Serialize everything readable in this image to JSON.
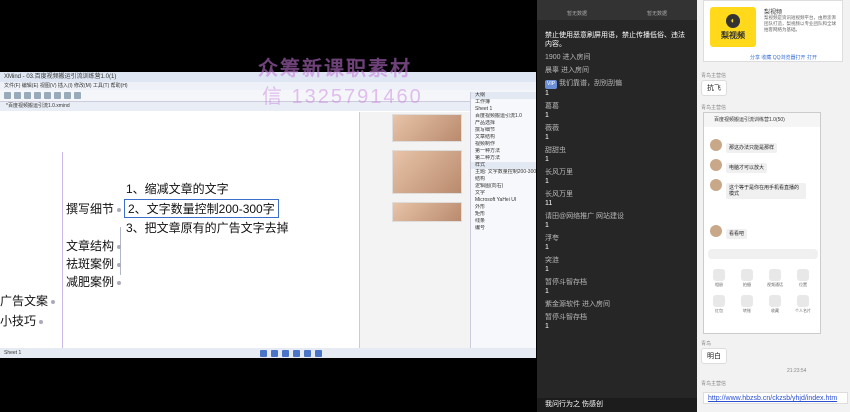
{
  "watermark": {
    "line1": "众筹新课职素材",
    "line2": "信 1325791460"
  },
  "xmind": {
    "title": "XMind - 03.百度视频搬运引流训练营1.0(1)",
    "menu": "文件(F)  编辑(E)  视图(V)  插入(I)  修改(M)  工具(T)  帮助(H)",
    "tab": "*百度视频搬运引流1.0.xmind",
    "nodes": {
      "main_sub": "撰写细节",
      "item1": "1、缩减文章的文字",
      "item2": "2、文字数量控制200-300字",
      "item3": "3、把文章原有的广告文字去掉",
      "structure": "文章结构",
      "spots": "祛斑案例",
      "diet": "减肥案例",
      "ad": "广告文案",
      "tips": "小技巧"
    },
    "panel_rows": [
      "大纲",
      "工作簿",
      "Sheet 1",
      "百度视频搬运引流1.0",
      "产品选择",
      "撰写细节",
      "文章结构",
      "视频制作",
      "第一种方法",
      "第二种方法",
      "样式",
      "主题: 文字数量控制200-300字",
      "结构",
      "逻辑图(向右)",
      "文字",
      "Microsoft YaHei UI",
      "外形",
      "矩形",
      "线条",
      "编号"
    ],
    "status": "Sheet 1"
  },
  "chat": {
    "top_tabs": [
      "暂无数据",
      "暂无数据"
    ],
    "messages": [
      {
        "name": "",
        "text": "禁止使用恶意刷屏用语，禁止传播低俗、违法内容。"
      },
      {
        "name": "1900 进入房间",
        "text": ""
      },
      {
        "name": "晨辜 进入房间",
        "text": ""
      },
      {
        "name": "我们靠谱，刮别刮偏",
        "text": "1",
        "badge": "VIP"
      },
      {
        "name": "葛葛",
        "text": "1"
      },
      {
        "name": "薇薇",
        "text": "1"
      },
      {
        "name": "甜甜虫",
        "text": "1"
      },
      {
        "name": "长风万里",
        "text": "1"
      },
      {
        "name": "长风万里",
        "text": "11"
      },
      {
        "name": "请田@网络推广 网站建设",
        "text": "1"
      },
      {
        "name": "浮夸",
        "text": "1"
      },
      {
        "name": "突涟",
        "text": "1"
      },
      {
        "name": "暂停斗智存档",
        "text": "1"
      },
      {
        "name": "紫金源软件 进入房间",
        "text": ""
      },
      {
        "name": "暂停斗智存档",
        "text": "1"
      }
    ],
    "last": "我问行为之 伤感创"
  },
  "right": {
    "card_title": "梨视频",
    "card_logo": "梨视频",
    "card_desc": "梨视频是资讯短视频平台，由原澎湃团队打造，梨视频以专业团队和全球拍客网络为基础。",
    "card_links": "分享  收藏  QQ浏览器打开  打开",
    "q1": "青鸟主营信",
    "bubble1": "抗飞",
    "q2": "青鸟主营信",
    "phone_header": "百度视频搬运引流训练营1.0(50)",
    "phone_msgs": [
      "那这办法只能是那样",
      "电脑才可以放大",
      "这个等于是你在用手机看直播的模式",
      "看看吧"
    ],
    "phone_icons": [
      "相册",
      "拍摄",
      "视频通话",
      "位置",
      "红包",
      "转账",
      "收藏",
      "个人名片"
    ],
    "q3": "青鸟",
    "bubble2": "明白",
    "time": "21:23:54",
    "q4": "青鸟主营信",
    "url": "http://www.hbzsb.cn/ckzsb/yhjd/index.htm"
  }
}
